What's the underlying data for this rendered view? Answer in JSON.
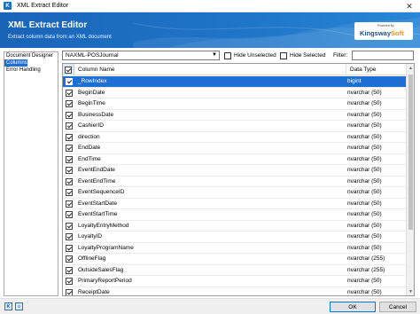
{
  "window": {
    "title": "XML Extract Editor",
    "app_icon_letter": "K",
    "close_glyph": "✕"
  },
  "banner": {
    "title": "XML Extract Editor",
    "subtitle": "Extract column data from an XML document",
    "logo": {
      "powered_by": "Powered By",
      "brand_main": "Kingsway",
      "brand_accent": "Soft"
    }
  },
  "nav": {
    "items": [
      {
        "label": "Document Designer",
        "active": false
      },
      {
        "label": "Columns",
        "active": true
      },
      {
        "label": "Error Handling",
        "active": false
      }
    ]
  },
  "toolbar": {
    "output_select": "NAXML-POSJournal",
    "hide_unselected": "Hide Unselected",
    "hide_selected": "Hide Selected",
    "filter_label": "Filter:",
    "filter_value": ""
  },
  "grid": {
    "columns": [
      "Column Name",
      "Data Type"
    ],
    "rows": [
      {
        "name": "_RowIndex",
        "type": "bigint",
        "checked": true,
        "selected": true
      },
      {
        "name": "BeginDate",
        "type": "nvarchar (50)",
        "checked": true
      },
      {
        "name": "BeginTime",
        "type": "nvarchar (50)",
        "checked": true
      },
      {
        "name": "BusinessDate",
        "type": "nvarchar (50)",
        "checked": true
      },
      {
        "name": "CashierID",
        "type": "nvarchar (50)",
        "checked": true
      },
      {
        "name": "direction",
        "type": "nvarchar (50)",
        "checked": true
      },
      {
        "name": "EndDate",
        "type": "nvarchar (50)",
        "checked": true
      },
      {
        "name": "EndTime",
        "type": "nvarchar (50)",
        "checked": true
      },
      {
        "name": "EventEndDate",
        "type": "nvarchar (50)",
        "checked": true
      },
      {
        "name": "EventEndTime",
        "type": "nvarchar (50)",
        "checked": true
      },
      {
        "name": "EventSequenceID",
        "type": "nvarchar (50)",
        "checked": true
      },
      {
        "name": "EventStartDate",
        "type": "nvarchar (50)",
        "checked": true
      },
      {
        "name": "EventStartTime",
        "type": "nvarchar (50)",
        "checked": true
      },
      {
        "name": "LoyaltyEntryMethod",
        "type": "nvarchar (50)",
        "checked": true
      },
      {
        "name": "LoyaltyID",
        "type": "nvarchar (50)",
        "checked": true
      },
      {
        "name": "LoyaltyProgramName",
        "type": "nvarchar (50)",
        "checked": true
      },
      {
        "name": "OfflineFlag",
        "type": "nvarchar (255)",
        "checked": true
      },
      {
        "name": "OutsideSalesFlag",
        "type": "nvarchar (255)",
        "checked": true
      },
      {
        "name": "PrimaryReportPeriod",
        "type": "nvarchar (50)",
        "checked": true
      },
      {
        "name": "ReceiptDate",
        "type": "nvarchar (50)",
        "checked": true
      }
    ]
  },
  "footer": {
    "ok": "OK",
    "cancel": "Cancel"
  },
  "colors": {
    "accent": "#1f6ed4",
    "banner": "#1a64b8",
    "brand_accent": "#f08a1c"
  }
}
